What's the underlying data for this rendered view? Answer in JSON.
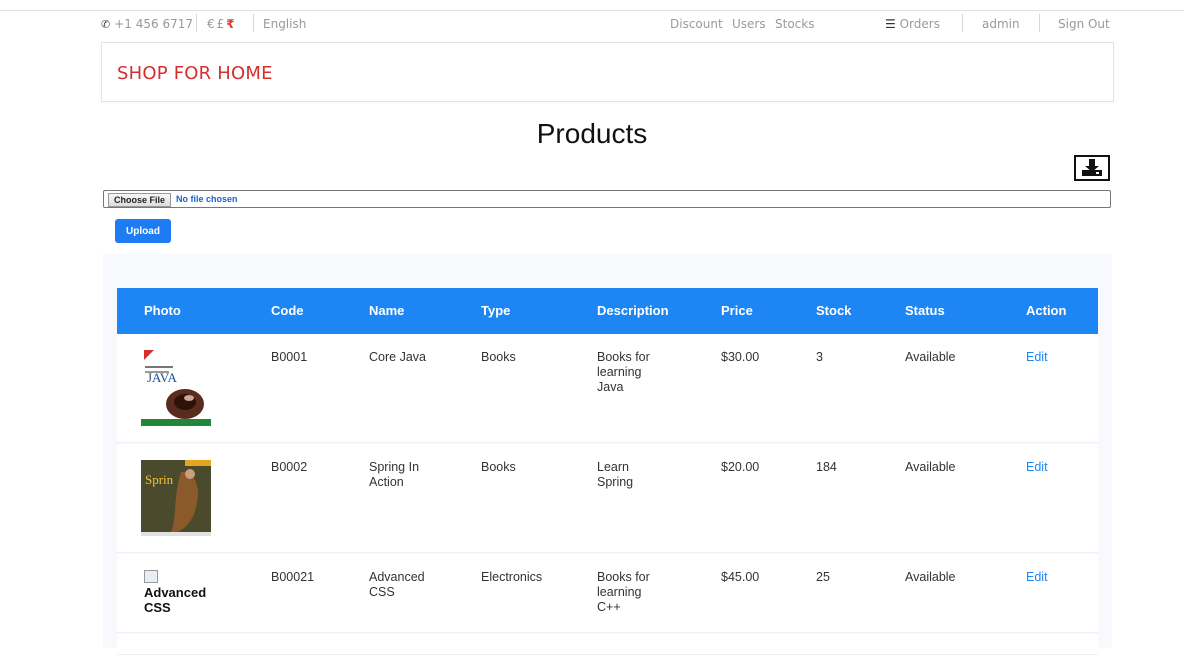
{
  "topbar": {
    "phone": "+1 456 6717",
    "currencies": [
      "€",
      "£",
      "₹"
    ],
    "language": "English",
    "nav": [
      "Discount",
      "Users",
      "Stocks"
    ],
    "orders_label": "Orders",
    "user": "admin",
    "signout": "Sign Out"
  },
  "brand": "SHOP FOR HOME",
  "page_title": "Products",
  "upload_form": {
    "choose_label": "Choose File",
    "no_file": "No file chosen",
    "upload_label": "Upload"
  },
  "table": {
    "headers": [
      "Photo",
      "Code",
      "Name",
      "Type",
      "Description",
      "Price",
      "Stock",
      "Status",
      "Action"
    ],
    "rows": [
      {
        "photo": "core-java-cover",
        "code": "B0001",
        "name": "Core Java",
        "type": "Books",
        "description": "Books for learning Java",
        "price": "$30.00",
        "stock": "3",
        "status": "Available",
        "action": "Edit"
      },
      {
        "photo": "spring-in-action-cover",
        "code": "B0002",
        "name": "Spring In Action",
        "type": "Books",
        "description": "Learn Spring",
        "price": "$20.00",
        "stock": "184",
        "status": "Available",
        "action": "Edit"
      },
      {
        "photo_alt": "Advanced CSS",
        "code": "B00021",
        "name": "Advanced CSS",
        "type": "Electronics",
        "description": "Books for learning C++",
        "price": "$45.00",
        "stock": "25",
        "status": "Available",
        "action": "Edit"
      }
    ]
  },
  "colors": {
    "accent": "#1d86f4",
    "brand": "#d32f2f"
  }
}
